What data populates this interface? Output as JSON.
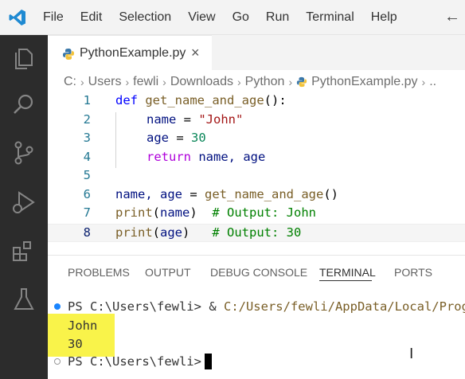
{
  "menu": [
    "File",
    "Edit",
    "Selection",
    "View",
    "Go",
    "Run",
    "Terminal",
    "Help"
  ],
  "tab": {
    "label": "PythonExample.py",
    "close": "×"
  },
  "breadcrumb": {
    "parts": [
      "C:",
      "Users",
      "fewli",
      "Downloads",
      "Python",
      "PythonExample.py",
      ".."
    ],
    "separator": "›"
  },
  "editor": {
    "line_numbers": [
      "1",
      "2",
      "3",
      "4",
      "5",
      "6",
      "7",
      "8"
    ],
    "current_line": "8",
    "lines": {
      "l1": {
        "def": "def",
        "fn": "get_name_and_age",
        "rest": "():"
      },
      "l2": {
        "var": "name",
        "op": " = ",
        "str": "\"John\""
      },
      "l3": {
        "var": "age",
        "op": " = ",
        "num": "30"
      },
      "l4": {
        "kw": "return",
        "rest": " name, age"
      },
      "l6": {
        "vars": "name, age",
        "op": " = ",
        "fn": "get_name_and_age",
        "rest": "()"
      },
      "l7": {
        "fn": "print",
        "open": "(",
        "var": "name",
        "close": ")",
        "cmt": "  # Output: John"
      },
      "l8": {
        "fn": "print",
        "open": "(",
        "var": "age",
        "close": ")",
        "cmt": "   # Output: 30"
      }
    }
  },
  "panel": {
    "tabs": [
      "PROBLEMS",
      "OUTPUT",
      "DEBUG CONSOLE",
      "TERMINAL",
      "PORTS"
    ],
    "active_tab": "TERMINAL"
  },
  "terminal": {
    "prompt1": "PS C:\\Users\\fewli> ",
    "amp": "& ",
    "cmd_path": "C:/Users/fewli/AppData/Local/Progra",
    "output1": "John",
    "output2": "30",
    "prompt2": "PS C:\\Users\\fewli> "
  },
  "colors": {
    "activity_bar": "#2c2c2c",
    "accent": "#0066b8",
    "highlight": "#f9f34a"
  }
}
